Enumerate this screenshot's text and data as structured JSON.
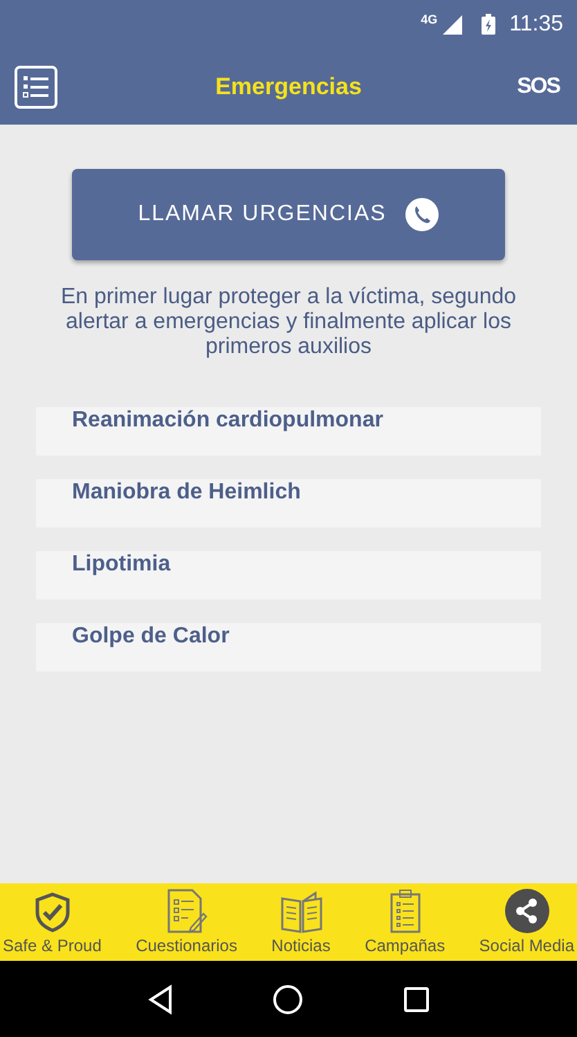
{
  "status_bar": {
    "network": "4G",
    "time": "11:35"
  },
  "toolbar": {
    "title": "Emergencias",
    "action": "SOS"
  },
  "call_button": {
    "label": "LLAMAR URGENCIAS"
  },
  "instructions": "En primer lugar proteger a la víctima, segundo alertar a emergencias y finalmente aplicar los primeros auxilios",
  "topics": [
    {
      "label": "Reanimación cardiopulmonar"
    },
    {
      "label": "Maniobra de Heimlich"
    },
    {
      "label": "Lipotimia"
    },
    {
      "label": "Golpe de Calor"
    }
  ],
  "bottom_nav": [
    {
      "label": "Safe & Proud",
      "kind": "shield"
    },
    {
      "label": "Cuestionarios",
      "kind": "quiz"
    },
    {
      "label": "Noticias",
      "kind": "book"
    },
    {
      "label": "Campañas",
      "kind": "clipboard"
    },
    {
      "label": "Social Media",
      "kind": "share"
    }
  ]
}
